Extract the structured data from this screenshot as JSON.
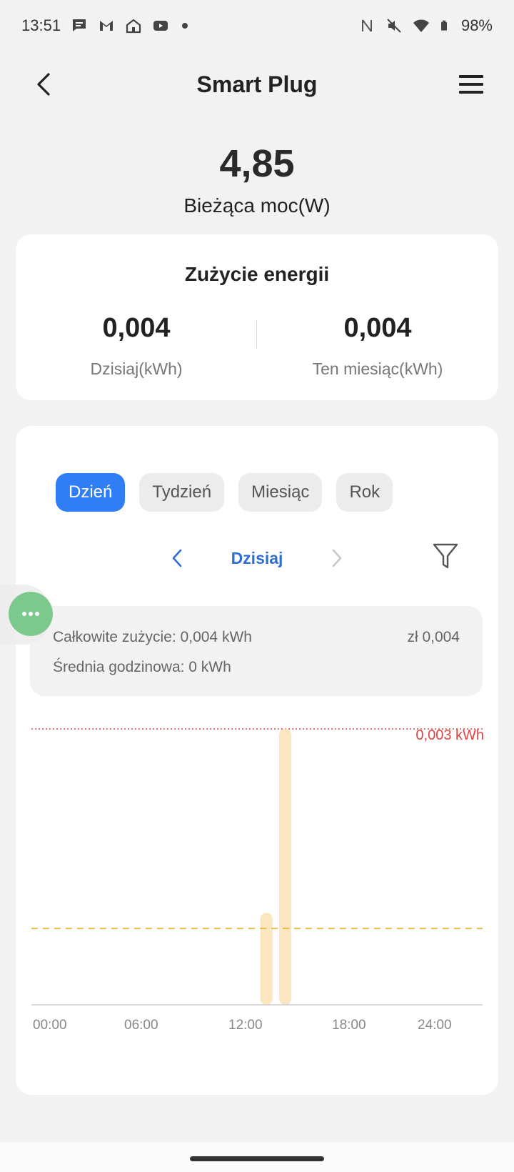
{
  "status_bar": {
    "time": "13:51",
    "battery": "98%",
    "icons_left": [
      "chat-icon",
      "gmail-icon",
      "home-icon",
      "youtube-icon",
      "dot-icon"
    ],
    "icons_right": [
      "nfc-icon",
      "mute-icon",
      "wifi-icon",
      "battery-icon"
    ]
  },
  "header": {
    "title": "Smart Plug"
  },
  "power": {
    "value": "4,85",
    "label": "Bieżąca moc(W)"
  },
  "energy": {
    "title": "Zużycie energii",
    "today_value": "0,004",
    "today_label": "Dzisiaj(kWh)",
    "month_value": "0,004",
    "month_label": "Ten miesiąc(kWh)"
  },
  "tabs": [
    {
      "label": "Dzień",
      "active": true
    },
    {
      "label": "Tydzień",
      "active": false
    },
    {
      "label": "Miesiąc",
      "active": false
    },
    {
      "label": "Rok",
      "active": false
    }
  ],
  "date_nav": {
    "label": "Dzisiaj"
  },
  "summary": {
    "total": "Całkowite zużycie: 0,004 kWh",
    "cost": "zł 0,004",
    "average": "Średnia godzinowa: 0 kWh"
  },
  "chart_data": {
    "type": "bar",
    "x_ticks": [
      "00:00",
      "06:00",
      "12:00",
      "18:00",
      "24:00"
    ],
    "xlim": [
      0,
      24
    ],
    "ylim": [
      0,
      0.003
    ],
    "max_line_label": "0,003 kWh",
    "bars": [
      {
        "hour": 12,
        "value": 0.001
      },
      {
        "hour": 13,
        "value": 0.003
      }
    ],
    "average_line": 0.00083,
    "colors": {
      "bar": "#fbe6c0",
      "max_line": "#e04545",
      "avg_line": "#e8b33a",
      "axis": "#cccccc"
    }
  }
}
